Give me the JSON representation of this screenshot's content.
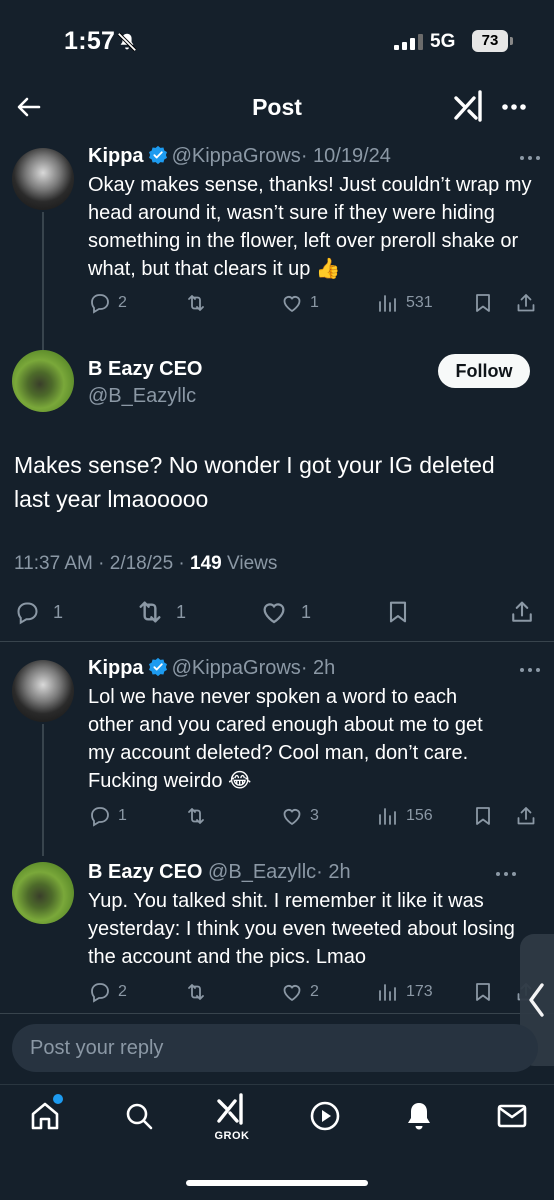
{
  "status_bar": {
    "time": "1:57",
    "network": "5G",
    "battery": "73"
  },
  "header": {
    "title": "Post"
  },
  "tweets": [
    {
      "name": "Kippa",
      "handle": "@KippaGrows",
      "time": "· 10/19/24",
      "text": "Okay makes sense, thanks! Just couldn’t wrap my head around it, wasn’t sure if they were hiding something in the flower, left over preroll shake or what, but that clears it up 👍",
      "replies": "2",
      "reposts": "",
      "likes": "1",
      "views": "531"
    },
    {
      "name": "Kippa",
      "handle": "@KippaGrows",
      "time": "· 2h",
      "text": "Lol we have never spoken a word to each other and you cared enough about me to get my account deleted? Cool man, don’t care. Fucking weirdo 😂",
      "replies": "1",
      "reposts": "",
      "likes": "3",
      "views": "156"
    },
    {
      "name": "B Eazy CEO",
      "handle": "@B_Eazyllc",
      "time": "· 2h",
      "text": "Yup. You talked shit. I remember it like it was yesterday: I think you even tweeted about losing the account and the pics. Lmao",
      "replies": "2",
      "reposts": "",
      "likes": "2",
      "views": "173"
    }
  ],
  "main_post": {
    "name": "B Eazy CEO",
    "handle": "@B_Eazyllc",
    "follow_label": "Follow",
    "text": "Makes sense? No wonder I got your IG deleted last year lmaooooo",
    "timestamp": "11:37 AM · 2/18/25 · ",
    "views_count": "149",
    "views_label": " Views",
    "replies": "1",
    "reposts": "1",
    "likes": "1"
  },
  "reply_bar": {
    "placeholder": "Post your reply"
  },
  "tabbar": {
    "grok_label": "GROK"
  },
  "colors": {
    "background": "#15202b",
    "accent": "#1d9bf0",
    "muted": "#8b98a5",
    "divider": "#38444d"
  }
}
